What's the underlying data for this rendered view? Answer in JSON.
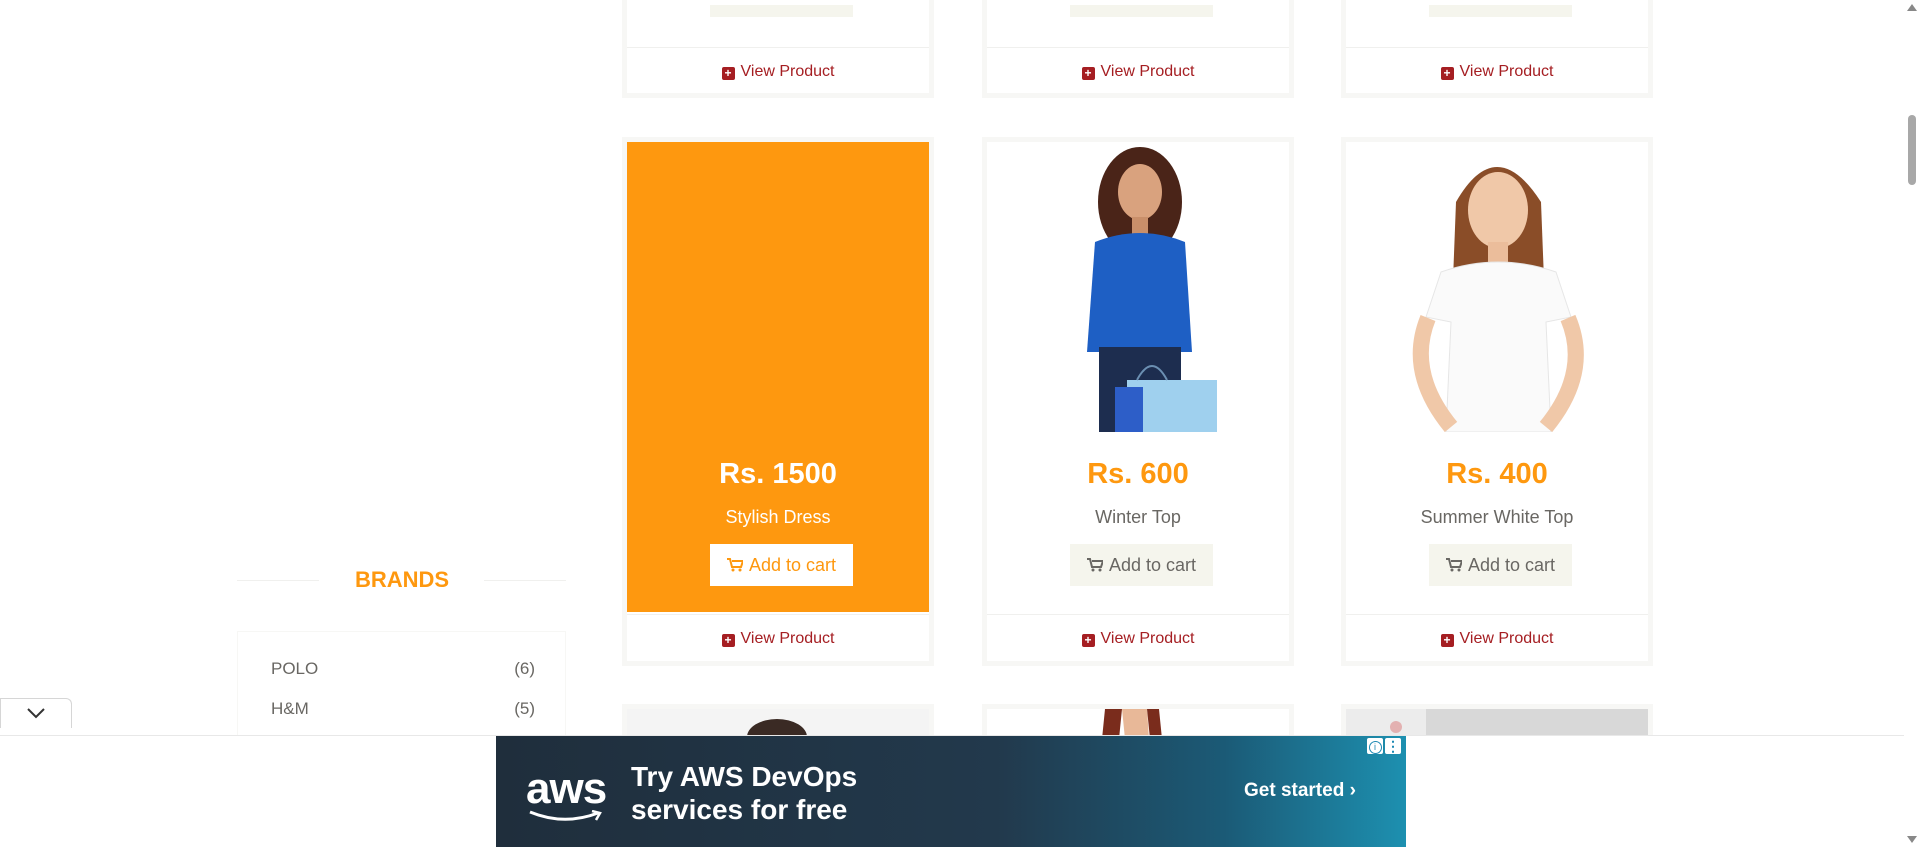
{
  "top_row": {
    "view_label": "View Product"
  },
  "products": [
    {
      "price": "Rs. 1500",
      "name": "Stylish Dress",
      "cart_label": "Add to cart",
      "view_label": "View Product"
    },
    {
      "price": "Rs. 600",
      "name": "Winter Top",
      "cart_label": "Add to cart",
      "view_label": "View Product"
    },
    {
      "price": "Rs. 400",
      "name": "Summer White Top",
      "cart_label": "Add to cart",
      "view_label": "View Product"
    }
  ],
  "brands": {
    "title": "BRANDS",
    "items": [
      {
        "name": "POLO",
        "count": "(6)"
      },
      {
        "name": "H&M",
        "count": "(5)"
      }
    ]
  },
  "ad": {
    "logo": "aws",
    "headline_line1": "Try AWS DevOps",
    "headline_line2": "services for free",
    "cta": "Get started ›",
    "info_icon": "info-icon",
    "menu_icon": "kebab-menu-icon"
  },
  "colors": {
    "accent": "#fe980f",
    "link": "#a51e22",
    "text": "#696763"
  }
}
